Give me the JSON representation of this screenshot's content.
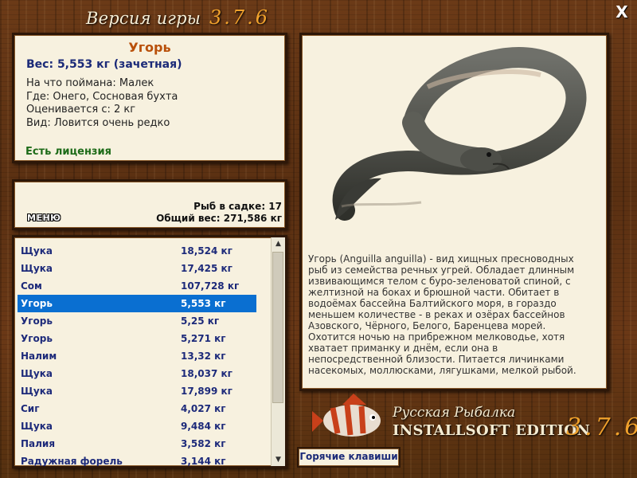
{
  "header": {
    "title": "Версия игры",
    "version": "3.7.6",
    "close_label": "X"
  },
  "fish_info": {
    "name": "Угорь",
    "weight_line": "Вес: 5,553 кг (зачетная)",
    "caught_on": "На что поймана: Малек",
    "location": "Где: Онего, Сосновая бухта",
    "rated_from": "Оценивается с: 2 кг",
    "rarity": "Вид: Ловится очень редко",
    "license": "Есть лицензия"
  },
  "stats": {
    "count_line": "Рыб в садке: 17",
    "total_line": "Общий вес: 271,586 кг",
    "menu_label": "МЕНЮ"
  },
  "catch_list": {
    "items": [
      {
        "name": "Щука",
        "weight": "18,524 кг"
      },
      {
        "name": "Щука",
        "weight": "17,425 кг"
      },
      {
        "name": "Сом",
        "weight": "107,728 кг"
      },
      {
        "name": "Угорь",
        "weight": "5,553 кг"
      },
      {
        "name": "Угорь",
        "weight": "5,25 кг"
      },
      {
        "name": "Угорь",
        "weight": "5,271 кг"
      },
      {
        "name": "Налим",
        "weight": "13,32 кг"
      },
      {
        "name": "Щука",
        "weight": "18,037 кг"
      },
      {
        "name": "Щука",
        "weight": "17,899 кг"
      },
      {
        "name": "Сиг",
        "weight": "4,027 кг"
      },
      {
        "name": "Щука",
        "weight": "9,484 кг"
      },
      {
        "name": "Палия",
        "weight": "3,582 кг"
      },
      {
        "name": "Радужная форель",
        "weight": "3,144 кг"
      }
    ],
    "selected_index": 3
  },
  "description": "Угорь (Anguilla anguilla) - вид хищных пресноводных рыб из семейства речных угрей. Обладает длинным извивающимся телом с буро-зеленоватой спиной, с желтизной на боках и брюшной части. Обитает в водоёмах бассейна Балтийского моря, в гораздо меньшем количестве - в реках и озёрах бассейнов Азовского, Чёрного, Белого, Баренцева морей. Охотится ночью на прибрежном мелководье, хотя хватает приманку и днём, если она в непосредственной близости. Питается личинками насекомых, моллюсками, лягушками, мелкой рыбой.",
  "logo": {
    "line1": "Русская Рыбалка",
    "line2": "INSTALLSOFT EDITION",
    "version": "3.7.6"
  },
  "hotkeys_label": "Горячие клавиши",
  "colors": {
    "wood": "#5a3012",
    "panel": "#f7f1df",
    "accent_orange": "#f0a12c",
    "fish_name": "#b9500a",
    "list_text": "#1d2a7a",
    "selection": "#0a6fd1",
    "license": "#1d6b18"
  }
}
